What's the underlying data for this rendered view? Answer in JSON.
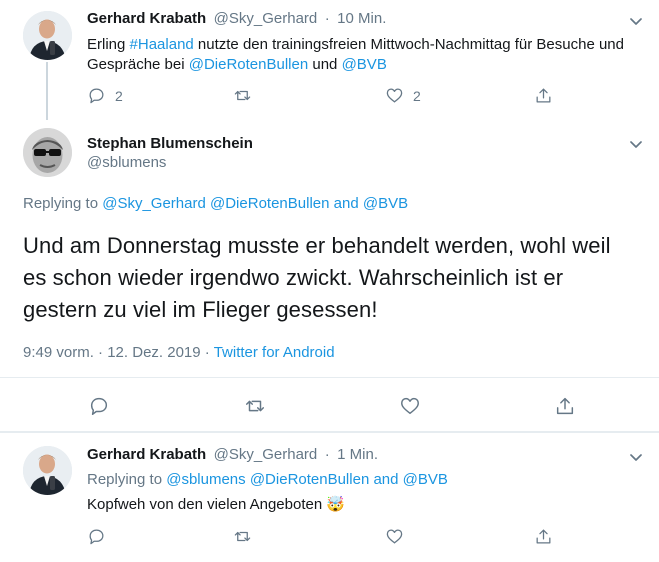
{
  "tweet1": {
    "name": "Gerhard Krabath",
    "handle": "@Sky_Gerhard",
    "separator": "·",
    "time": "10 Min.",
    "text_parts": [
      "Erling ",
      "#Haaland",
      " nutzte den trainingsfreien Mittwoch-Nachmittag für Besuche und Gespräche bei ",
      "@DieRotenBullen",
      " und ",
      "@BVB"
    ],
    "reply_count": "2",
    "like_count": "2"
  },
  "main_tweet": {
    "name": "Stephan Blumenschein",
    "handle": "@sblumens",
    "replying_prefix": "Replying to ",
    "replying_user1": "@Sky_Gerhard",
    "replying_user2": "@DieRotenBullen",
    "replying_and": " and ",
    "replying_user3": "@BVB",
    "text": "Und am Donnerstag musste er behandelt werden, wohl weil es schon wieder irgendwo zwickt. Wahrscheinlich ist er gestern zu viel im Flieger gesessen!",
    "time": "9:49 vorm.",
    "sep": " · ",
    "date": "12. Dez. 2019",
    "sep2": " · ",
    "source": "Twitter for Android"
  },
  "tweet3": {
    "name": "Gerhard Krabath",
    "handle": "@Sky_Gerhard",
    "separator": "·",
    "time": "1 Min.",
    "replying_prefix": "Replying to ",
    "replying_user1": "@sblumens",
    "replying_user2": "@DieRotenBullen",
    "replying_and": " and ",
    "replying_user3": "@BVB",
    "text": "Kopfweh von den vielen Angeboten",
    "emoji": "🤯"
  },
  "icons": [
    "chevron-down-icon",
    "reply-icon",
    "retweet-icon",
    "like-icon",
    "share-icon"
  ],
  "colors": {
    "link": "#1b95e0",
    "secondary_text": "#657786",
    "border": "#e6ecf0",
    "text": "#14171a"
  }
}
